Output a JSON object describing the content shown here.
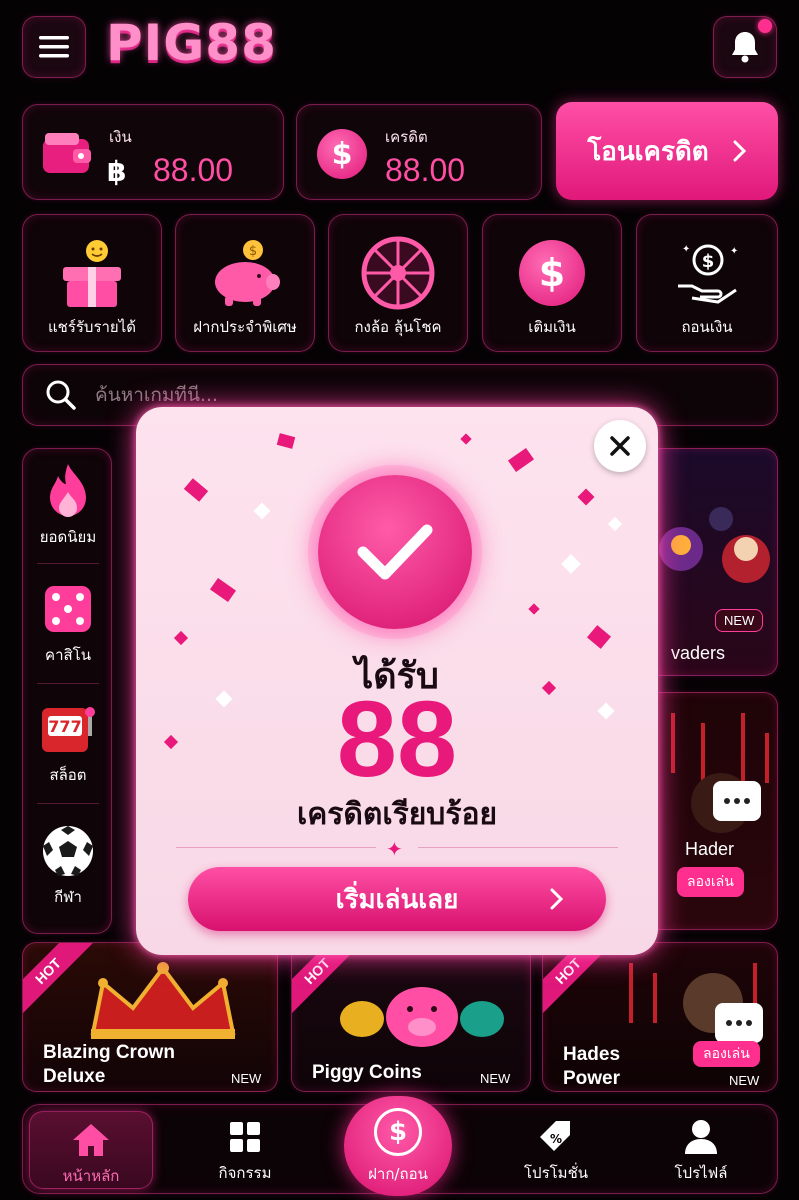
{
  "header": {
    "logo": "PIG88",
    "menu_icon": "hamburger-icon",
    "bell_icon": "bell-icon"
  },
  "balance": {
    "wallet_label": "เงิน",
    "wallet_currency": "฿",
    "wallet_value": "88.00",
    "credit_label": "เครดิต",
    "credit_value": "88.00",
    "transfer_label": "โอนเครดิต"
  },
  "quick_actions": [
    {
      "label": "แชร์รับรายได้",
      "icon": "gift-icon"
    },
    {
      "label": "ฝากประจำพิเศษ",
      "icon": "piggy-bank-icon"
    },
    {
      "label": "กงล้อ ลุ้นโชค",
      "icon": "wheel-icon"
    },
    {
      "label": "เติมเงิน",
      "icon": "dollar-coin-icon"
    },
    {
      "label": "ถอนเงิน",
      "icon": "hand-money-icon"
    }
  ],
  "search": {
    "placeholder": "ค้นหาเกมที่นี่..."
  },
  "sidebar": {
    "items": [
      {
        "label": "ยอดนิยม",
        "icon": "fire-icon"
      },
      {
        "label": "คาสิโน",
        "icon": "dice-icon"
      },
      {
        "label": "สล็อต",
        "icon": "slot-machine-icon"
      },
      {
        "label": "กีฬา",
        "icon": "soccer-ball-icon"
      }
    ]
  },
  "games": {
    "right_top": {
      "title": "vaders",
      "tag": "NEW"
    },
    "right_mid": {
      "title": "Hader",
      "play": "ลองเล่น"
    },
    "bottom": [
      {
        "title_line1": "Blazing Crown",
        "title_line2": "Deluxe",
        "tag": "NEW",
        "ribbon": "HOT"
      },
      {
        "title_line1": "Piggy Coins",
        "title_line2": "",
        "tag": "NEW",
        "ribbon": "HOT"
      },
      {
        "title_line1": "Hades",
        "title_line2": "Power",
        "tag": "NEW",
        "ribbon": "HOT",
        "play": "ลองเล่น"
      }
    ]
  },
  "modal": {
    "received": "ได้รับ",
    "amount": "88",
    "credit_text": "เครดิตเรียบร้อย",
    "start_button": "เริ่มเล่นเลย"
  },
  "bottom_nav": {
    "items": [
      {
        "label": "หน้าหลัก",
        "icon": "home-icon"
      },
      {
        "label": "กิจกรรม",
        "icon": "grid-icon"
      },
      {
        "label": "ฝาก/ถอน",
        "icon": "dollar-coin-icon"
      },
      {
        "label": "โปรโมชั่น",
        "icon": "promo-tag-icon"
      },
      {
        "label": "โปรไฟล์",
        "icon": "user-icon"
      }
    ]
  },
  "colors": {
    "accent": "#ff2f8f",
    "background": "#050204",
    "modal_bg": "#fde3ee"
  }
}
